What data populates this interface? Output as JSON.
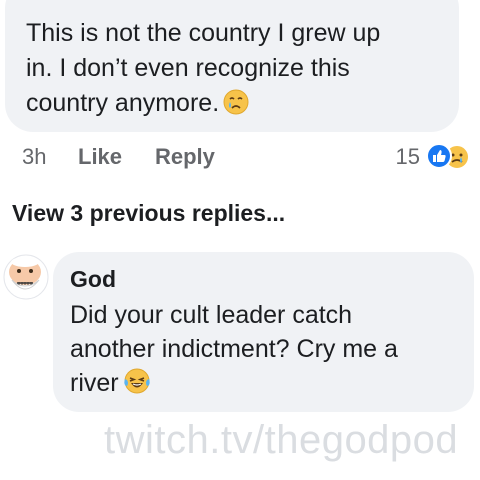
{
  "comment": {
    "lines": [
      "This is not the country I grew up",
      "in. I don’t even recognize this",
      "country anymore."
    ],
    "emoji": "crying-face-icon",
    "time": "3h",
    "like_label": "Like",
    "reply_label": "Reply",
    "reaction_count": "15",
    "reaction_icons": [
      "like-reaction-icon",
      "sad-reaction-icon"
    ]
  },
  "view_replies_label": "View 3 previous replies...",
  "reply": {
    "author": "God",
    "lines": [
      "Did your cult leader catch",
      "another indictment? Cry me a",
      "river"
    ],
    "emoji": "laughing-tears-icon",
    "avatar": "god-avatar"
  },
  "watermark": "twitch.tv/thegodpod",
  "colors": {
    "bubble": "#f0f2f5",
    "text": "#1c1e21",
    "meta_text": "#65676b",
    "like_blue": "#1877f2",
    "watermark": "#dadde1"
  }
}
